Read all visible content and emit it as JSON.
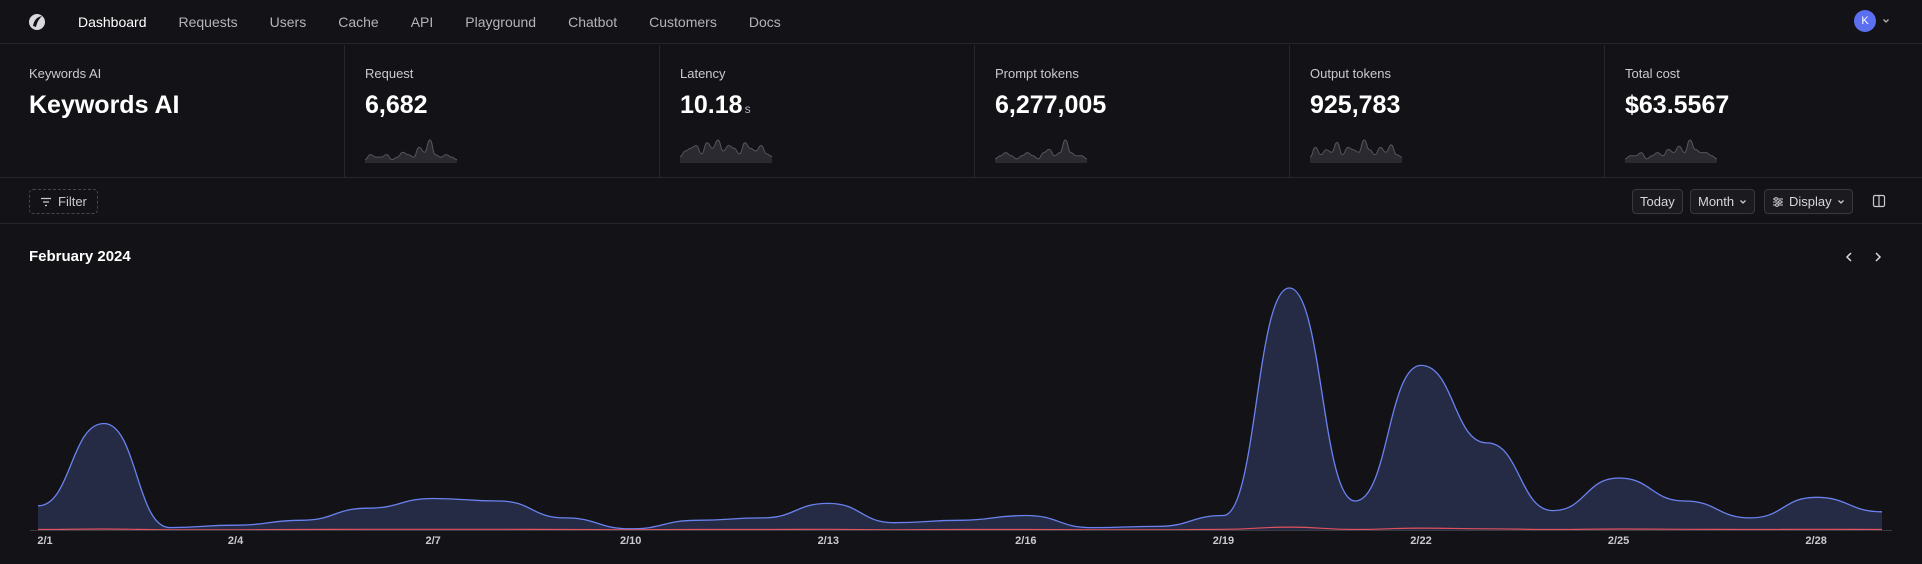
{
  "nav": {
    "items": [
      {
        "label": "Dashboard",
        "active": true
      },
      {
        "label": "Requests"
      },
      {
        "label": "Users"
      },
      {
        "label": "Cache"
      },
      {
        "label": "API"
      },
      {
        "label": "Playground"
      },
      {
        "label": "Chatbot"
      },
      {
        "label": "Customers"
      },
      {
        "label": "Docs"
      }
    ],
    "avatar_initial": "K"
  },
  "metrics": [
    {
      "label": "Keywords AI",
      "value": "Keywords AI",
      "unit": "",
      "spark": []
    },
    {
      "label": "Request",
      "value": "6,682",
      "unit": "",
      "spark": [
        1,
        3,
        2,
        2,
        3,
        1,
        2,
        4,
        3,
        2,
        6,
        4,
        9,
        3,
        2,
        3,
        2,
        1
      ]
    },
    {
      "label": "Latency",
      "value": "10.18",
      "unit": "s",
      "spark": [
        2,
        4,
        5,
        6,
        3,
        7,
        5,
        8,
        4,
        6,
        5,
        3,
        7,
        5,
        4,
        6,
        3,
        2
      ]
    },
    {
      "label": "Prompt tokens",
      "value": "6,277,005",
      "unit": "",
      "spark": [
        1,
        2,
        3,
        2,
        1,
        2,
        3,
        2,
        1,
        3,
        4,
        2,
        3,
        7,
        3,
        2,
        2,
        1
      ]
    },
    {
      "label": "Output tokens",
      "value": "925,783",
      "unit": "",
      "spark": [
        2,
        6,
        3,
        5,
        4,
        8,
        3,
        6,
        5,
        4,
        9,
        5,
        3,
        6,
        4,
        7,
        3,
        2
      ]
    },
    {
      "label": "Total cost",
      "value": "$63.5567",
      "unit": "",
      "spark": [
        1,
        2,
        2,
        3,
        1,
        2,
        3,
        2,
        4,
        3,
        5,
        3,
        7,
        4,
        3,
        3,
        2,
        1
      ]
    }
  ],
  "toolbar": {
    "filter_label": "Filter",
    "today_label": "Today",
    "month_label": "Month",
    "display_label": "Display"
  },
  "chart_data": {
    "type": "area",
    "title": "February 2024",
    "x_ticks": [
      "2/1",
      "2/4",
      "2/7",
      "2/10",
      "2/13",
      "2/16",
      "2/19",
      "2/22",
      "2/25",
      "2/28"
    ],
    "ylim": [
      0,
      1000
    ],
    "grid": false,
    "colors": {
      "primary": "#6a82f0",
      "secondary": "#e0525f",
      "fill": "#262b45"
    },
    "series": [
      {
        "color": "#6a82f0",
        "x": [
          "2/1",
          "2/2",
          "2/3",
          "2/4",
          "2/5",
          "2/6",
          "2/7",
          "2/8",
          "2/9",
          "2/10",
          "2/11",
          "2/12",
          "2/13",
          "2/14",
          "2/15",
          "2/16",
          "2/17",
          "2/18",
          "2/19",
          "2/20",
          "2/21",
          "2/22",
          "2/23",
          "2/24",
          "2/25",
          "2/26",
          "2/27",
          "2/28",
          "2/29"
        ],
        "values": [
          100,
          440,
          10,
          20,
          40,
          90,
          130,
          120,
          50,
          5,
          40,
          50,
          110,
          30,
          40,
          60,
          10,
          15,
          60,
          1000,
          120,
          680,
          360,
          80,
          215,
          120,
          50,
          135,
          75
        ]
      },
      {
        "color": "#e0525f",
        "x": [
          "2/1",
          "2/2",
          "2/3",
          "2/4",
          "2/5",
          "2/6",
          "2/7",
          "2/8",
          "2/9",
          "2/10",
          "2/11",
          "2/12",
          "2/13",
          "2/14",
          "2/15",
          "2/16",
          "2/17",
          "2/18",
          "2/19",
          "2/20",
          "2/21",
          "2/22",
          "2/23",
          "2/24",
          "2/25",
          "2/26",
          "2/27",
          "2/28",
          "2/29"
        ],
        "values": [
          2,
          4,
          1,
          1,
          2,
          3,
          3,
          3,
          2,
          1,
          2,
          2,
          3,
          1,
          2,
          2,
          1,
          1,
          3,
          12,
          2,
          8,
          5,
          2,
          4,
          3,
          2,
          3,
          2
        ]
      }
    ]
  }
}
